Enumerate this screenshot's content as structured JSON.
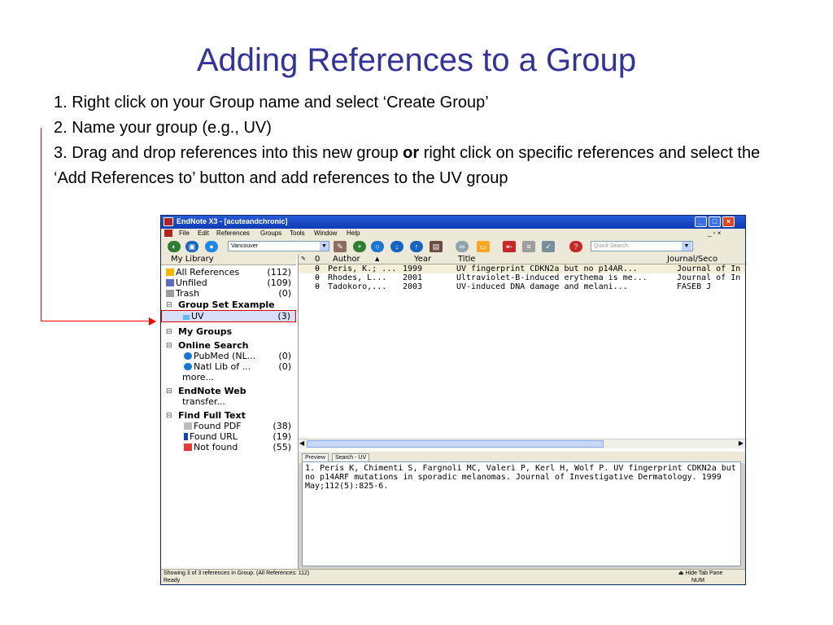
{
  "slide": {
    "title": "Adding References to a Group",
    "step1": "1. Right click on your Group name and select ‘Create Group’",
    "step2": "2. Name your group (e.g., UV)",
    "step3_pre": "3. Drag and drop references into this new group ",
    "step3_bold": "or",
    "step3_post": " right click on specific references and select the ‘Add References to’ button and add references to the UV group"
  },
  "window": {
    "title": "EndNote X3 - [acuteandchronic]",
    "minimize": "_",
    "maximize": "□",
    "close": "×",
    "child_controls": "_ ▫ ×"
  },
  "menu": [
    "File",
    "Edit",
    "References",
    "Groups",
    "Tools",
    "Window",
    "Help"
  ],
  "toolbar": {
    "style_value": "Vancouver",
    "quick_search_placeholder": "Quick Search"
  },
  "groups": {
    "my_library_header": "My Library",
    "library": [
      {
        "label": "All References",
        "count": "(112)"
      },
      {
        "label": "Unfiled",
        "count": "(109)"
      },
      {
        "label": "Trash",
        "count": "(0)"
      }
    ],
    "group_set": "Group Set Example",
    "uv": {
      "label": "UV",
      "count": "(3)"
    },
    "my_groups": "My Groups",
    "online_search": "Online Search",
    "online_items": [
      {
        "label": "PubMed (NL...",
        "count": "(0)"
      },
      {
        "label": "Natl Lib of ...",
        "count": "(0)"
      }
    ],
    "more": "more...",
    "endnote_web": "EndNote Web",
    "transfer": "transfer...",
    "find_full_text": "Find Full Text",
    "full_text_items": [
      {
        "label": "Found PDF",
        "count": "(38)"
      },
      {
        "label": "Found URL",
        "count": "(19)"
      },
      {
        "label": "Not found",
        "count": "(55)"
      }
    ]
  },
  "columns": {
    "author": "Author",
    "year": "Year",
    "title": "Title",
    "journal": "Journal/Seco"
  },
  "references": [
    {
      "author": "Peris, K.; ...",
      "year": "1999",
      "title": "UV fingerprint CDKN2a but no p14AR...",
      "journal": "Journal of In"
    },
    {
      "author": "Rhodes, L...",
      "year": "2001",
      "title": "Ultraviolet-B-induced erythema is me...",
      "journal": "Journal of In"
    },
    {
      "author": "Tadokoro,...",
      "year": "2003",
      "title": "UV-induced DNA damage and melani...",
      "journal": "FASEB J"
    }
  ],
  "tabs": [
    "Preview",
    "Search - UV"
  ],
  "preview_text": "1.       Peris K, Chimenti S, Fargnoli MC, Valeri P, Kerl H, Wolf P. UV fingerprint CDKN2a but no p14ARF mutations in sporadic melanomas. Journal of Investigative Dermatology. 1999 May;112(5):825-6.",
  "status": {
    "showing": "Showing 3 of 3 references in Group. (All References: 112)",
    "hide_tab_pane": "Hide Tab Pane",
    "ready": "Ready",
    "num": "NUM"
  },
  "colors": {
    "title": "#333399",
    "arrow": "#ff0000",
    "selection": "#d6dff7"
  }
}
